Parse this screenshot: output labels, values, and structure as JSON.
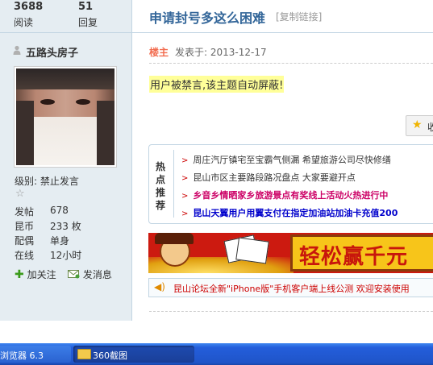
{
  "stats": [
    {
      "num": "3688",
      "label": "阅读"
    },
    {
      "num": "51",
      "label": "回复"
    }
  ],
  "thread": {
    "title": "申请封号多这么困难",
    "copy_link": "[复制链接]"
  },
  "author": {
    "name": "五路头房子",
    "group": "级别: 禁止发言",
    "info": [
      {
        "key": "发帖",
        "value": "678"
      },
      {
        "key": "昆币",
        "value": "233 枚"
      },
      {
        "key": "配偶",
        "value": "单身"
      },
      {
        "key": "在线",
        "value": "12小时"
      }
    ],
    "follow": "加关注",
    "message": "发消息"
  },
  "post": {
    "floor_label": "楼主",
    "time": "发表于: 2013-12-17",
    "banned_notice": "用户被禁言,该主题自动屏蔽!",
    "favorite": "收"
  },
  "hot": {
    "title": "热点推荐",
    "items": [
      {
        "text": "周庄汽厅镇宅至宝霸气侧漏 希望旅游公司尽快修缮",
        "color": "#333333",
        "bold": false
      },
      {
        "text": "昆山市区主要路段路况盘点 大家要避开点",
        "color": "#333333",
        "bold": false
      },
      {
        "text": "乡音乡情晒家乡旅游景点有奖线上活动火热进行中",
        "color": "#cc0066",
        "bold": true
      },
      {
        "text": "昆山天翼用户用翼支付在指定加油站加油卡充值200",
        "color": "#0000cc",
        "bold": true
      }
    ]
  },
  "ad": {
    "text": "轻松赢千元"
  },
  "notice": {
    "text": "昆山论坛全新\"iPhone版\"手机客户端上线公测 欢迎安装使用"
  },
  "taskbar": {
    "items": [
      "浏览器 6.3",
      "360截图"
    ]
  }
}
